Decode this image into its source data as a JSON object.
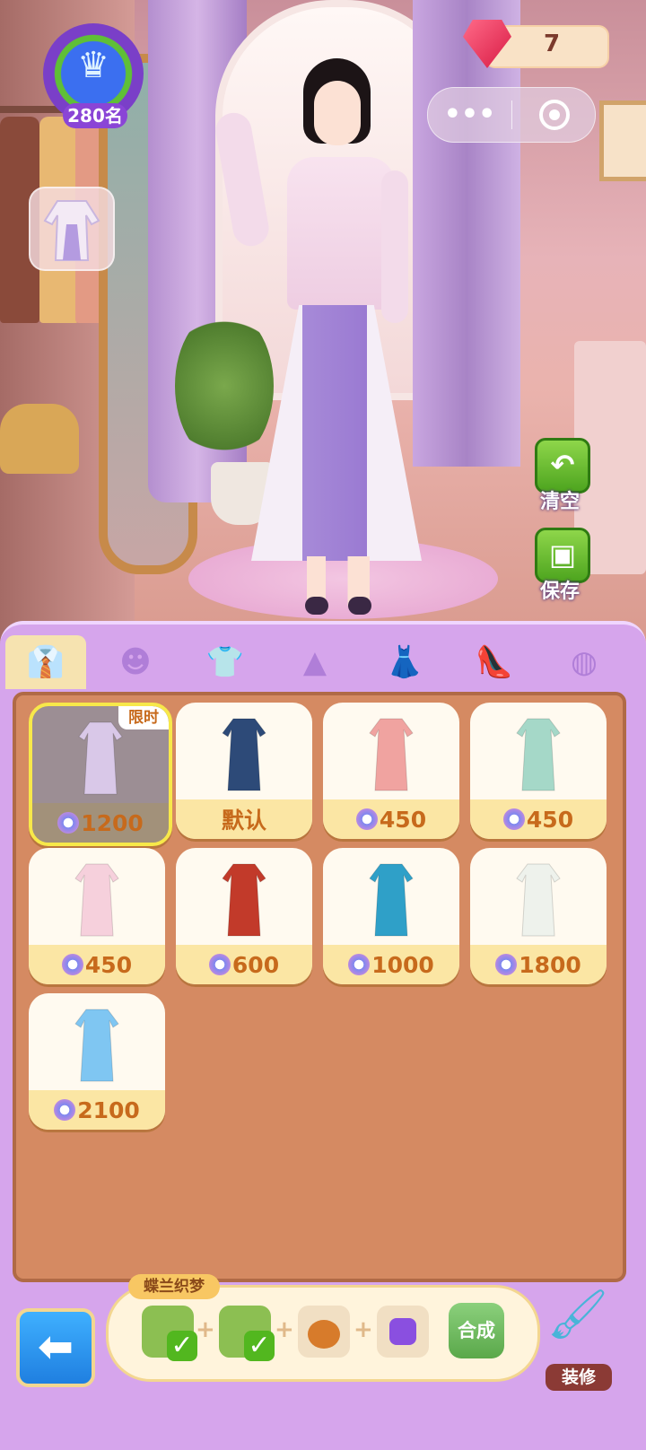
{
  "header": {
    "rank_label": "280名",
    "gem_count": "7",
    "capsule_more": "•••"
  },
  "side_actions": {
    "clear_label": "清空",
    "save_label": "保存"
  },
  "tabs": [
    {
      "icon": "suit-icon",
      "glyph": "👔",
      "active": true
    },
    {
      "icon": "hair-icon",
      "glyph": "☻",
      "active": false
    },
    {
      "icon": "shirt-icon",
      "glyph": "👕",
      "active": false
    },
    {
      "icon": "skirt-icon",
      "glyph": "▲",
      "active": false
    },
    {
      "icon": "dress-icon",
      "glyph": "👗",
      "active": false
    },
    {
      "icon": "heel-icon",
      "glyph": "👠",
      "active": false
    },
    {
      "icon": "accessory-icon",
      "glyph": "◍",
      "active": false
    }
  ],
  "items": [
    {
      "price": "1200",
      "tag": "限时",
      "selected": true,
      "color": "#d9c8e8"
    },
    {
      "price": "默认",
      "tag": "",
      "selected": false,
      "color": "#2d4a78"
    },
    {
      "price": "450",
      "tag": "",
      "selected": false,
      "color": "#f0a3a0"
    },
    {
      "price": "450",
      "tag": "",
      "selected": false,
      "color": "#a5d8c8"
    },
    {
      "price": "450",
      "tag": "",
      "selected": false,
      "color": "#f6d0dc"
    },
    {
      "price": "600",
      "tag": "",
      "selected": false,
      "color": "#c23a2a"
    },
    {
      "price": "1000",
      "tag": "",
      "selected": false,
      "color": "#2fa0c8"
    },
    {
      "price": "1800",
      "tag": "",
      "selected": false,
      "color": "#eef2ec"
    },
    {
      "price": "2100",
      "tag": "",
      "selected": false,
      "color": "#7fc6f2"
    }
  ],
  "recipe": {
    "title": "蝶兰织梦",
    "craft_label": "合成",
    "plus": "+"
  },
  "bottom": {
    "back_glyph": "⬅",
    "decor_label": "装修"
  }
}
